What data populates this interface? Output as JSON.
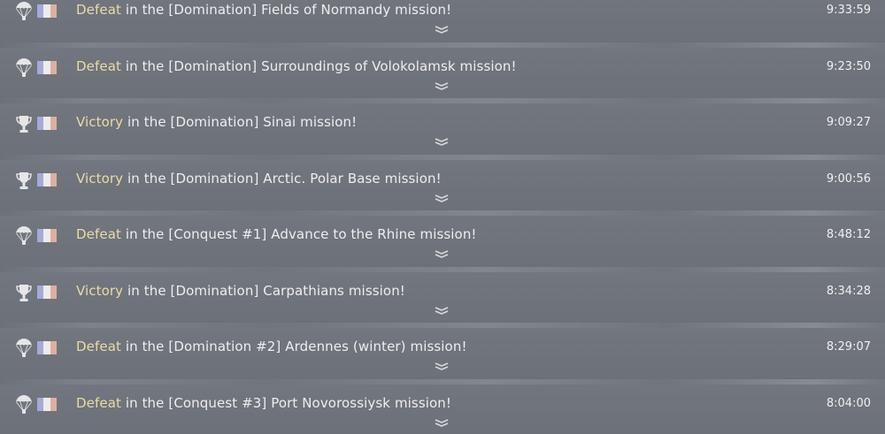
{
  "rows": [
    {
      "icon": "parachute-icon",
      "result": "Defeat",
      "text": " in the [Domination] Fields of Normandy mission!",
      "time": "9:33:59"
    },
    {
      "icon": "parachute-icon",
      "result": "Defeat",
      "text": " in the [Domination] Surroundings of Volokolamsk mission!",
      "time": "9:23:50"
    },
    {
      "icon": "trophy-icon",
      "result": "Victory",
      "text": " in the [Domination] Sinai mission!",
      "time": "9:09:27"
    },
    {
      "icon": "trophy-icon",
      "result": "Victory",
      "text": " in the [Domination] Arctic. Polar Base mission!",
      "time": "9:00:56"
    },
    {
      "icon": "parachute-icon",
      "result": "Defeat",
      "text": " in the [Conquest #1] Advance to the Rhine mission!",
      "time": "8:48:12"
    },
    {
      "icon": "trophy-icon",
      "result": "Victory",
      "text": " in the [Domination] Carpathians mission!",
      "time": "8:34:28"
    },
    {
      "icon": "parachute-icon",
      "result": "Defeat",
      "text": " in the [Domination #2] Ardennes (winter) mission!",
      "time": "8:29:07"
    },
    {
      "icon": "parachute-icon",
      "result": "Defeat",
      "text": " in the [Conquest #3] Port Novorossiysk mission!",
      "time": "8:04:00"
    }
  ],
  "colors": {
    "background": "#6f737b",
    "result_highlight": "#e9dca3",
    "text": "#eeeeee",
    "flag": [
      "#a7a8dc",
      "#ececec",
      "#dcb0a0"
    ]
  }
}
